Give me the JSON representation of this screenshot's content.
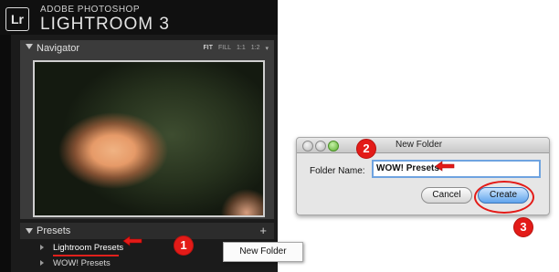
{
  "lightroom": {
    "logo": "Lr",
    "brand_top": "ADOBE PHOTOSHOP",
    "brand_main": "LIGHTROOM 3",
    "navigator": {
      "title": "Navigator",
      "zoom_options": [
        "FIT",
        "FILL",
        "1:1",
        "1:2"
      ]
    },
    "presets": {
      "title": "Presets",
      "add_symbol": "+",
      "items": [
        "Lightroom Presets",
        "WOW! Presets"
      ]
    },
    "context_menu": {
      "item": "New Folder"
    }
  },
  "dialog": {
    "title": "New Folder",
    "field_label": "Folder Name:",
    "field_value": "WOW! Presets",
    "cancel_label": "Cancel",
    "create_label": "Create"
  },
  "steps": [
    "1",
    "2",
    "3"
  ],
  "colors": {
    "annotation_red": "#e31b18",
    "create_button_blue": "#5fa4ec"
  }
}
